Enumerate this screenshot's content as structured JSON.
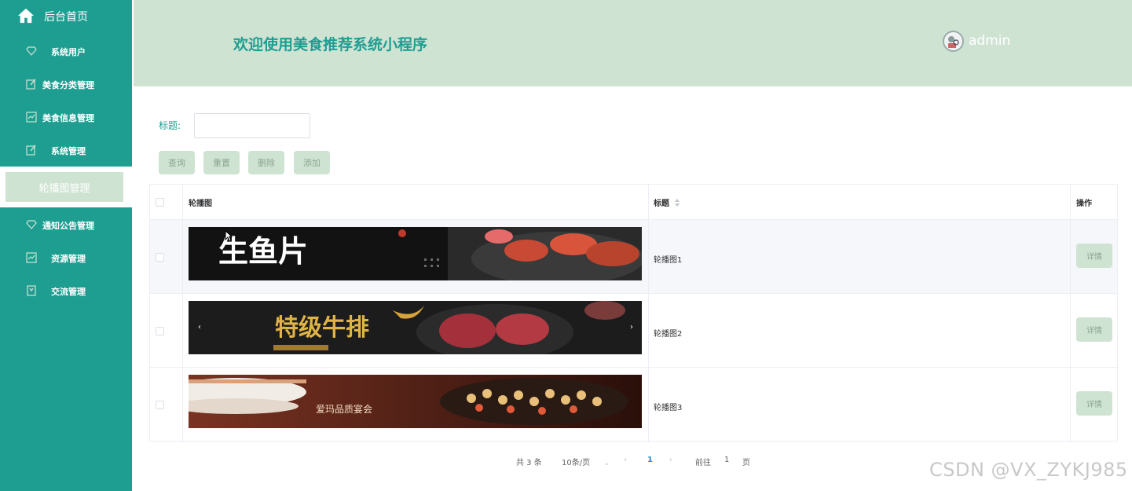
{
  "sidebar": {
    "home_label": "后台首页",
    "items": [
      {
        "label": "系统用户",
        "icon": "diamond-icon"
      },
      {
        "label": "美食分类管理",
        "icon": "edit-icon"
      },
      {
        "label": "美食信息管理",
        "icon": "chart-icon"
      },
      {
        "label": "系统管理",
        "icon": "edit-icon"
      },
      {
        "label": "轮播图管理",
        "active": true
      },
      {
        "label": "通知公告管理",
        "icon": "diamond-icon"
      },
      {
        "label": "资源管理",
        "icon": "chart-icon"
      },
      {
        "label": "交流管理",
        "icon": "bookmark-icon"
      }
    ]
  },
  "header": {
    "title": "欢迎使用美食推荐系统小程序",
    "username": "admin"
  },
  "filter": {
    "label": "标题:",
    "value": ""
  },
  "buttons": {
    "search": "查询",
    "reset": "重置",
    "delete": "删除",
    "add": "添加"
  },
  "table": {
    "columns": [
      "轮播图",
      "标题",
      "操作"
    ],
    "rows": [
      {
        "title": "轮播图1",
        "action": "详情",
        "banner_text": "生鱼片"
      },
      {
        "title": "轮播图2",
        "action": "详情",
        "banner_text": "特级牛排"
      },
      {
        "title": "轮播图3",
        "action": "详情",
        "banner_text": "爱玛品质宴会"
      }
    ]
  },
  "pagination": {
    "total": "共 3 条",
    "page_size": "10条/页",
    "prev": "‹",
    "current": "1",
    "next": "›",
    "goto_label": "前往",
    "goto_value": "1",
    "page_suffix": "页"
  },
  "watermark": "CSDN @VX_ZYKJ985",
  "colors": {
    "sidebar": "#1e9e91",
    "header": "#cfe3d3",
    "accent": "#1e9e91"
  }
}
